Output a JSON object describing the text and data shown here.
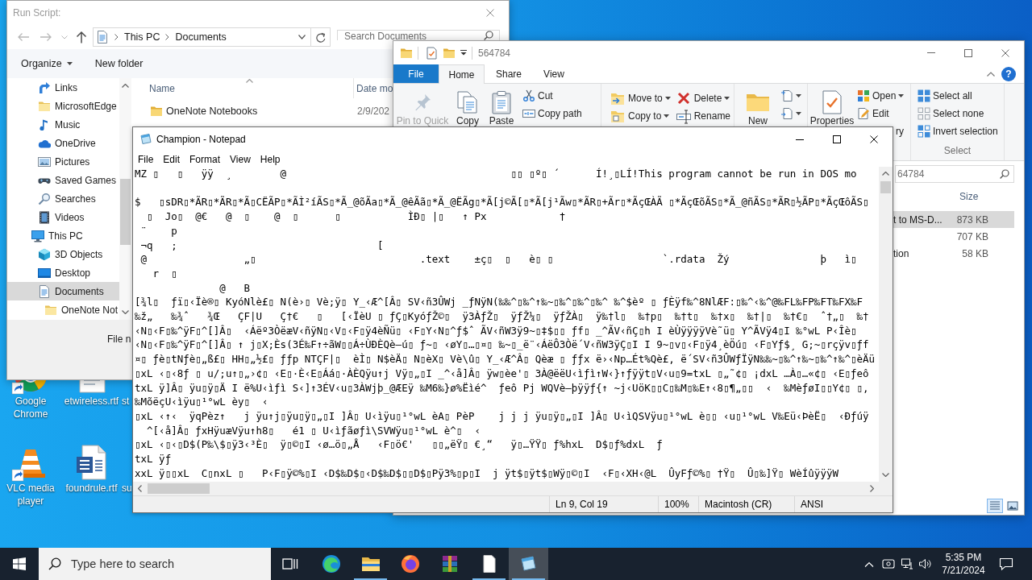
{
  "run_script_dialog": {
    "title": "Run Script:",
    "breadcrumb": [
      "This PC",
      "Documents"
    ],
    "search": {
      "placeholder": "Search Documents"
    },
    "commands": [
      {
        "label": "Organize",
        "dropdown": true
      },
      {
        "label": "New folder",
        "dropdown": false
      }
    ],
    "nav_pane": {
      "items": [
        {
          "label": "Links",
          "selected": false
        },
        {
          "label": "MicrosoftEdge",
          "selected": false
        },
        {
          "label": "Music",
          "selected": false
        },
        {
          "label": "OneDrive",
          "selected": false
        },
        {
          "label": "Pictures",
          "selected": false
        },
        {
          "label": "Saved Games",
          "selected": false
        },
        {
          "label": "Searches",
          "selected": false
        },
        {
          "label": "Videos",
          "selected": false
        }
      ],
      "tree": [
        {
          "label": "This PC",
          "selected": false,
          "children": [
            {
              "label": "3D Objects",
              "selected": false
            },
            {
              "label": "Desktop",
              "selected": false
            },
            {
              "label": "Documents",
              "selected": true,
              "children": [
                {
                  "label": "OneNote Not",
                  "selected": false
                }
              ]
            }
          ]
        }
      ]
    },
    "file_list": {
      "columns": [
        "Name",
        "Date mo"
      ],
      "rows": [
        {
          "name": "OneNote Notebooks",
          "date": "2/9/202"
        }
      ]
    },
    "file_name_label": "File n"
  },
  "explorer_window": {
    "title": "564784",
    "tabs": [
      {
        "label": "File",
        "kind": "menu",
        "selected": false
      },
      {
        "label": "Home",
        "kind": "tab",
        "selected": true
      },
      {
        "label": "Share",
        "kind": "tab",
        "selected": false
      },
      {
        "label": "View",
        "kind": "tab",
        "selected": false
      }
    ],
    "help": "?",
    "ribbon": [
      {
        "items": [
          {
            "label": "Pin to Quick",
            "kind": "large",
            "dropdown": false,
            "disabled": true
          },
          {
            "label": "Copy",
            "kind": "large",
            "dropdown": false,
            "disabled": false
          },
          {
            "label": "Paste",
            "kind": "large",
            "dropdown": false,
            "disabled": false
          },
          {
            "label": "Cut",
            "kind": "small",
            "dropdown": false,
            "disabled": false
          },
          {
            "label": "Copy path",
            "kind": "small",
            "dropdown": false,
            "disabled": false
          }
        ]
      },
      {
        "items": [
          {
            "label": "Move to",
            "kind": "medium",
            "dropdown": true,
            "disabled": false
          },
          {
            "label": "Copy to",
            "kind": "medium",
            "dropdown": true,
            "disabled": false
          },
          {
            "label": "Delete",
            "kind": "medium",
            "dropdown": true,
            "disabled": false
          },
          {
            "label": "Rename",
            "kind": "medium",
            "dropdown": false,
            "disabled": false
          }
        ]
      },
      {
        "items": [
          {
            "label": "New",
            "kind": "large",
            "dropdown": false,
            "disabled": false
          },
          {
            "kind": "small",
            "dropdown": true,
            "disabled": false
          },
          {
            "kind": "small",
            "dropdown": true,
            "disabled": false
          }
        ]
      },
      {
        "items": [
          {
            "label": "Properties",
            "kind": "large",
            "dropdown": false,
            "disabled": false
          },
          {
            "label": "Open",
            "kind": "small",
            "dropdown": true,
            "disabled": false
          },
          {
            "label": "Edit",
            "kind": "small",
            "dropdown": false,
            "disabled": false
          },
          {
            "label": "ry",
            "kind": "covered",
            "dropdown": false,
            "disabled": false
          }
        ]
      },
      {
        "label": "Select",
        "items": [
          {
            "label": "Select all",
            "kind": "small",
            "dropdown": false,
            "disabled": false
          },
          {
            "label": "Select none",
            "kind": "small",
            "dropdown": false,
            "disabled": false
          },
          {
            "label": "Invert selection",
            "kind": "small",
            "dropdown": false,
            "disabled": false
          }
        ]
      }
    ],
    "search": {
      "placeholder": "64784"
    },
    "columns": [
      "Size"
    ],
    "rows": [
      {
        "name": "t to MS-D...",
        "size": "873 KB",
        "selected": true
      },
      {
        "size": "707 KB",
        "selected": false
      },
      {
        "name": "tion",
        "size": "58 KB",
        "selected": false
      }
    ],
    "view_buttons": [
      {
        "selected": true
      },
      {
        "selected": false
      }
    ]
  },
  "notepad": {
    "title": "Champion - Notepad",
    "menu": [
      "File",
      "Edit",
      "Format",
      "View",
      "Help"
    ],
    "text": "MZ ▯   ▯   ÿÿ  ¸        @                                     ▯▯ ▯º▯ ´      Í!¸▯LÍ!This program cannot be run in DOS mo\n\n$   ▯sDR▯*ÃR▯*ÃR▯*Ã▯CËÃP▯*ÃÌ²íÃS▯*Ã_@õÃa▯*Ã_@êÃã▯*Ã_@ËÃg▯*Ã[j©Ã[▯*Ã[j¹Ãw▯*ÃR▯+Ãr▯*ÃçŒÀÃ ▯*ÃçŒõÃS▯*Ã_@ñÃS▯*ÃR▯½ÃP▯*ÃçŒôÃS▯\n  ▯  Jo▯  @€   @  ▯    @  ▯      ▯           ÌÐ▯ |▯   ↑ Px            †\n ¨    p\n ¬q   ;                                 [\n @                „▯                           .text    ±ç▯  ▯   è▯ ▯                  `.rdata  Žý               þ   ì▯\n   r  ▯\n              @   B\n[¾l▯  ƒï▯‹Ïè®▯ KyóNlè£▯ N(è›▯ Vè;ÿ▯ Y_‹Æ^[Â▯ SV‹ñ3ÛWj _ƒNÿN(‰‰^▯‰^↑‰~▯‰^▯‰^▯‰^ ‰^$èº ▯ ƒÈÿf‰^8NlÆF:▯‰^‹‰^@‰FL‰FP‰FT‰FX‰F\n‰ž„   ‰¾ˆ   ¾Œ   ÇF|U   Ç†€   ▯   [‹ÏèU ▯ ƒÇ▯KyóƒŽ©▯  ÿ3ÀƒŽ▯  ÿƒŽ¼▯  ÿƒŽÀ▯  ÿ‰†l▯  ‰†p▯  ‰†t▯  ‰†x▯  ‰†|▯  ‰†€▯  ˆ†„▯  ‰†\n‹N▯‹F▯‰^ÿF▯^[]Â▯  ‹Áëº3ÒëæV‹ñÿN▯‹V▯‹F▯ÿ4èÑü▯ ‹F▯Y‹N▯^ƒ$ˆ ÃV‹ñW3ÿ9~▯‡$▯▯ ƒf▯ _^ÃV‹ñÇ▯h I èÙÿÿÿÿVè˜ü▯ Y^ÃVÿ4▯I ‰°wL P‹Îè▯\n‹N▯‹F▯‰^ÿF▯^[]Â▯ ↑ j▯X;Ès(3É‰F↑÷ãW▯▯Á÷ÙÐÈQè–ú▯ ƒ~▯ ‹øY▯…▯¤▯ ‰~▯_ë¨‹ÁëÔ3Òë´V‹ñW3ÿÇ▯I I 9~▯v▯‹F▯ÿ4¸èÖú▯ ‹F▯Yƒ$¸ G;~▯rçÿv▯ƒf\n¤▯ ƒè▯tNƒè▯„ß£▯ HH▯„½£▯ ƒƒp NTÇF|▯  èÌ▯ N$èÄ▯ N▯èX▯ Vè\\û▯ Y_‹Æ^Â▯ Qèæ ▯ ƒƒx ë›‹Np…Ét%Qè£, ë´SV‹ñ3ÛWƒÏÿN‰‰~▯‰^↑‰~▯‰^↑‰^▯èÄü\n▯xL ‹▯‹8ƒ ▯ u/;u↑▯„›¢▯ ‹E▯·È‹E▯Áá▯·ÀÈQÿu↑j Vÿ▯„▯I _^‹å]Â▯ ÿw▯èe'▯ 3À@ëëU‹ìƒì↑W‹}↑ƒÿÿt▯V‹u▯9=txL ▯„˜¢▯ ¡dxL …À▯…«¢▯ ‹E▯ƒeô\ntxL ÿ]Â▯ ÿu▯ÿ▯Ä I ë%U‹ìƒì S‹]↑3ÉV‹u▯3ÀWjþ_@ÆEÿ ‰M6‰}ø%Ëìé^  ƒeô Pj WQVè–þÿÿƒ{↑ ~j‹UöK▯▯C▯‰M▯‰E↑‹8▯¶„▯▯  ‹  ‰MèƒøI▯▯Y¢▯ ▯,\n‰MõëçU‹ìÿu▯¹°wL èy▯  ‹\n▯xL ‹↑‹  ÿqPèz↑   j ÿu↑j▯ÿu▯ÿ▯„▯I ]Â▯ U‹ìÿu▯¹°wL èA▯ PèP    j j j ÿu▯ÿ▯„▯I ]Â▯ U‹ìQSVÿu▯¹°wL è▯▯ ‹u▯¹°wL V‰Eü‹ÞèË▯  ‹Ðƒúÿ\n  ^[‹å]Â▯ ƒxHÿuæVÿu↑h8▯   é1 ▯ U‹ìƒãøƒì\\SVWÿu▯¹°wL è^▯  ‹\n▯xL ‹▯‹▯D$(P‰\\$▯ÿ3‹³È▯  ÿ▯©▯I ‹ø…ö▯„Å   ‹F▯ö€'   ▯▯„ëŸ▯ €¸“   ÿ▯…ŸŸ▯ ƒ%hxL  D$▯ƒ%dxL  ƒ\ntxL ÿƒ\nxxL ÿ▯▯xL  C▯nxL ▯   P‹F▯ÿ©%▯I ‹D$‰D$▯‹D$‰D$▯▯D$▯Pÿ3%▯p▯I  j ÿt$▯ÿt$▯Wÿ▯©▯I  ‹F▯‹XH‹@L  ÛyFƒ©%▯ †Ÿ▯  Û▯‰]Ÿ▯ WèÍûÿÿÿW",
    "status_bar": [
      "Ln 9, Col 19",
      "100%",
      "Macintosh (CR)",
      "ANSI"
    ]
  },
  "desktop": {
    "icons": [
      {
        "label": "Google Chrome",
        "kind": "icon",
        "shortcut": true
      },
      {
        "label": "etwireless.rtf",
        "kind": "icon",
        "shortcut": false
      },
      {
        "label": "st",
        "kind": "covered"
      },
      {
        "label": "VLC media player",
        "kind": "icon",
        "shortcut": true
      },
      {
        "label": "foundrule.rtf",
        "kind": "icon",
        "shortcut": false
      },
      {
        "label": "su",
        "kind": "covered"
      }
    ]
  },
  "taskbar": {
    "search": {
      "placeholder": "Type here to search"
    },
    "apps": [
      {
        "open": false,
        "active": false
      },
      {
        "open": true,
        "active": false
      },
      {
        "open": false,
        "active": false
      },
      {
        "open": false,
        "active": false
      },
      {
        "open": true,
        "active": false
      },
      {
        "open": true,
        "active": true
      }
    ],
    "clock": {
      "time": "5:35 PM",
      "date": "7/21/2024"
    }
  }
}
